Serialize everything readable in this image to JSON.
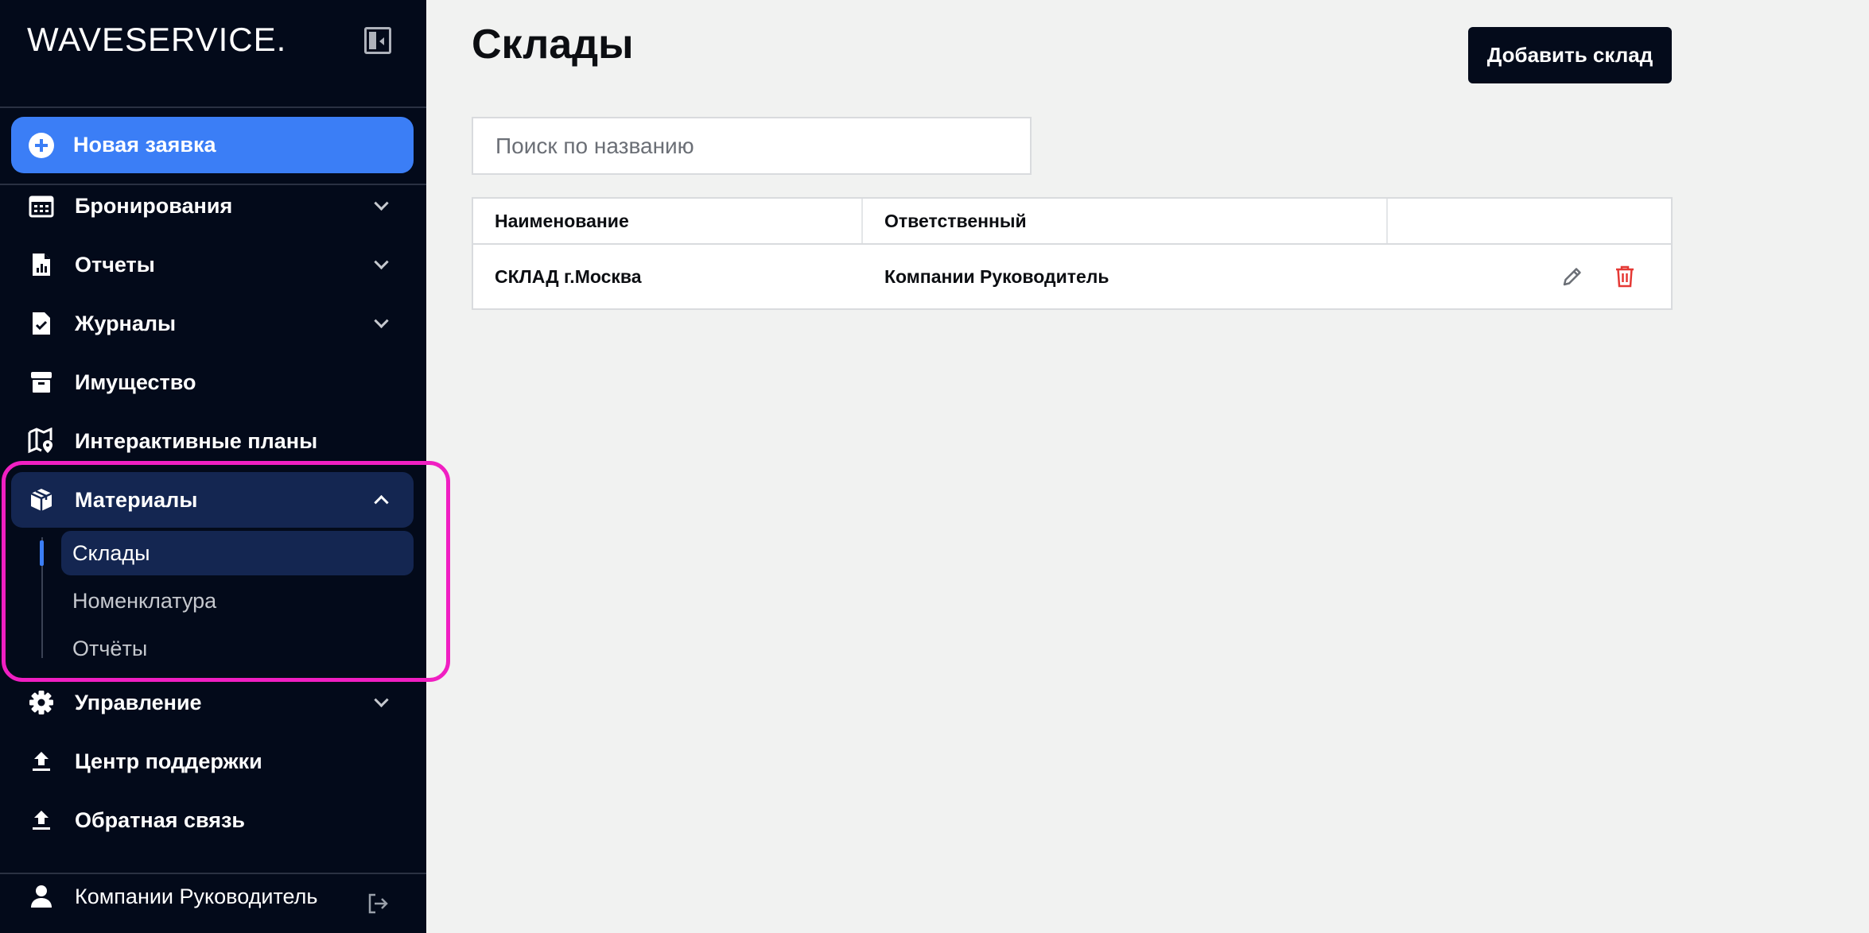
{
  "app": {
    "logo_part1": "WAVE",
    "logo_part2": "SERVICE."
  },
  "sidebar": {
    "new_request": "Новая заявка",
    "items": [
      {
        "label": "Бронирования",
        "icon": "calendar-icon",
        "expandable": true
      },
      {
        "label": "Отчеты",
        "icon": "report-icon",
        "expandable": true
      },
      {
        "label": "Журналы",
        "icon": "journal-icon",
        "expandable": true
      },
      {
        "label": "Имущество",
        "icon": "archive-icon",
        "expandable": false
      },
      {
        "label": "Интерактивные планы",
        "icon": "map-pin-icon",
        "expandable": false
      },
      {
        "label": "Материалы",
        "icon": "package-icon",
        "expandable": true,
        "expanded": true
      },
      {
        "label": "Управление",
        "icon": "gear-icon",
        "expandable": true
      },
      {
        "label": "Центр поддержки",
        "icon": "upload-icon",
        "expandable": false
      },
      {
        "label": "Обратная связь",
        "icon": "upload-icon",
        "expandable": false
      }
    ],
    "materials_sub": [
      {
        "label": "Склады",
        "active": true
      },
      {
        "label": "Номенклатура",
        "active": false
      },
      {
        "label": "Отчёты",
        "active": false
      }
    ],
    "user_name": "Компании Руководитель"
  },
  "main": {
    "title": "Склады",
    "add_button": "Добавить склад",
    "search_placeholder": "Поиск по названию",
    "table": {
      "columns": [
        "Наименование",
        "Ответственный",
        ""
      ],
      "rows": [
        {
          "name": "СКЛАД г.Москва",
          "responsible": "Компании Руководитель"
        }
      ]
    }
  },
  "colors": {
    "sidebar_bg": "#030a1a",
    "accent": "#3b7ef6",
    "active_bg": "#142651",
    "highlight": "#f01fc2",
    "delete": "#e53935"
  }
}
